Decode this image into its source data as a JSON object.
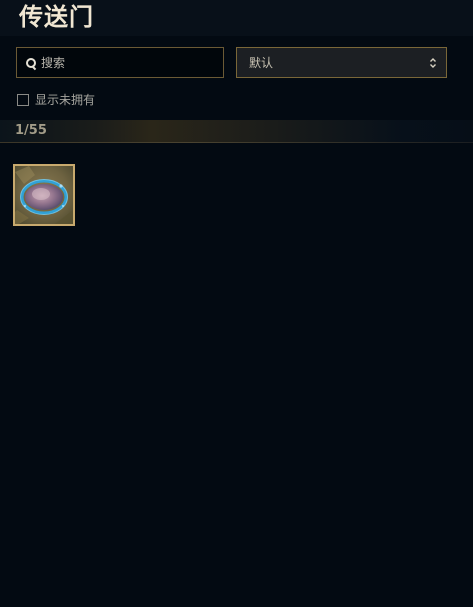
{
  "page": {
    "title": "传送门"
  },
  "search": {
    "placeholder": "搜索",
    "value": "",
    "icon": "search-icon"
  },
  "sort": {
    "selected": "默认",
    "icon": "chevron-updown-icon"
  },
  "filter": {
    "show_unowned_label": "显示未拥有",
    "show_unowned_checked": false
  },
  "collection": {
    "count_text": "1/55",
    "items": [
      {
        "kind": "portal-thumbnail",
        "owned": true
      }
    ]
  },
  "colors": {
    "background": "#030a12",
    "accent_gold": "#c8aa6e",
    "title": "#f0e6d2",
    "portal_glow": "#4fc3f7"
  }
}
